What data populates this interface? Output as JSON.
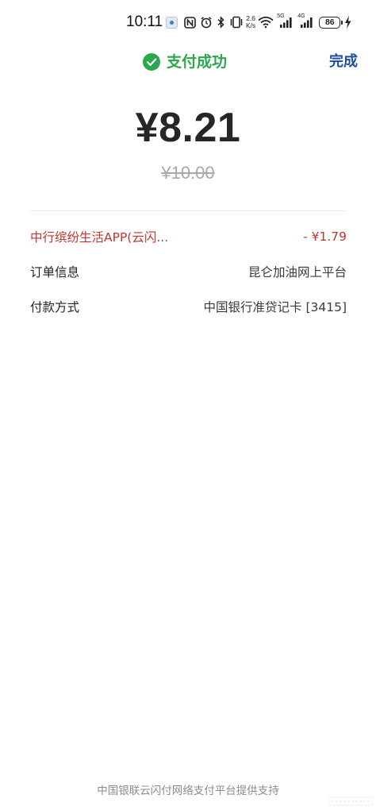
{
  "status_bar": {
    "time": "10:11",
    "net_speed_value": "2.6",
    "net_speed_unit": "K/s",
    "net_1_label": "5G",
    "net_2_label": "4G",
    "battery_level": "86",
    "icons": [
      "app-notification-icon",
      "nfc-icon",
      "alarm-icon",
      "bluetooth-icon",
      "vibrate-icon",
      "wifi-icon",
      "cellular-signal-icon",
      "charging-icon"
    ]
  },
  "header": {
    "status_text": "支付成功",
    "done_label": "完成"
  },
  "payment": {
    "amount": "¥8.21",
    "original_amount": "¥10.00"
  },
  "details": {
    "discount": {
      "label": "中行缤纷生活APP(云闪...",
      "value": "- ¥1.79"
    },
    "order": {
      "label": "订单信息",
      "value": "昆仑加油网上平台"
    },
    "method": {
      "label": "付款方式",
      "value": "中国银行准贷记卡 [3415]"
    }
  },
  "footer": {
    "text": "中国银联云闪付网络支付平台提供支持"
  },
  "colors": {
    "success_green": "#2ba84e",
    "done_blue": "#1e4f9a",
    "discount_red": "#c23531",
    "muted_gray": "#a8a8a8"
  }
}
